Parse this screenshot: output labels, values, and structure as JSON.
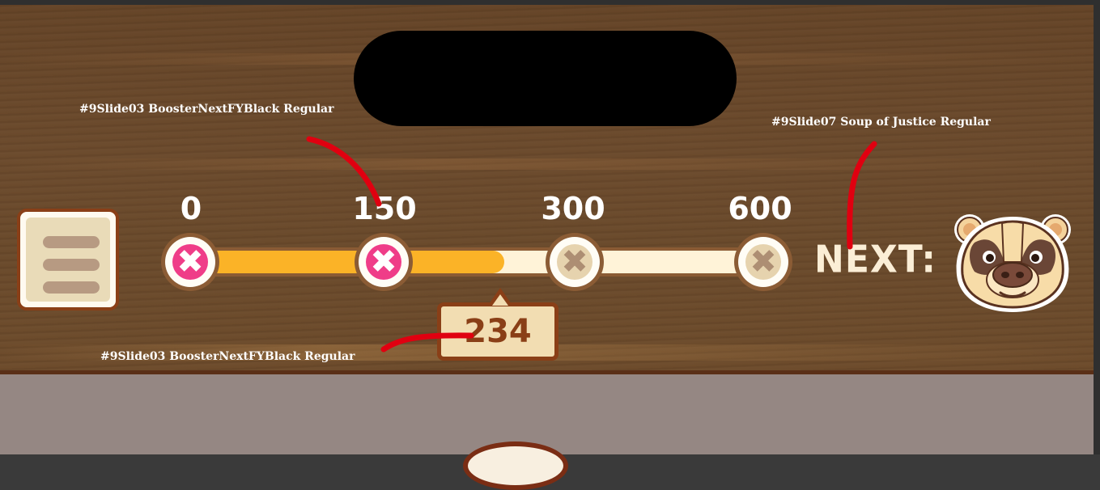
{
  "annotations": {
    "milestone_font_note": "#9Slide03 BoosterNextFYBlack Regular",
    "next_font_note": "#9Slide07 Soup of Justice Regular",
    "score_font_note": "#9Slide03 BoosterNextFYBlack Regular"
  },
  "progress": {
    "milestones": [
      {
        "label": "0",
        "state": "claimed",
        "icon": "x-icon"
      },
      {
        "label": "150",
        "state": "claimed",
        "icon": "x-icon"
      },
      {
        "label": "300",
        "state": "locked",
        "icon": "x-icon"
      },
      {
        "label": "600",
        "state": "locked",
        "icon": "x-icon"
      }
    ],
    "current_score": "234",
    "fill_fraction": 0.55
  },
  "next": {
    "label": "NEXT:",
    "reward_icon": "badger-icon"
  },
  "menu": {
    "icon": "hamburger-menu-icon"
  },
  "colors": {
    "wood": "#6a4a2b",
    "progress_fill": "#fbb327",
    "claimed": "#ef3d88",
    "locked": "#e6d3ae",
    "outline": "#8a3f17",
    "annotation_red": "#e00010"
  }
}
